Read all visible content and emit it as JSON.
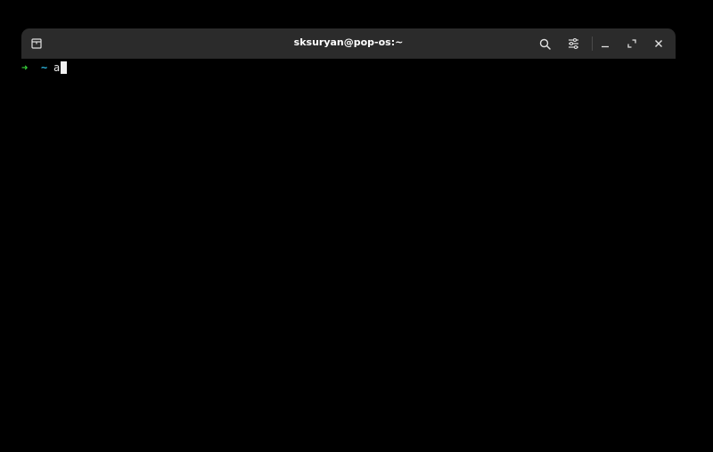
{
  "window": {
    "title": "sksuryan@pop-os:~"
  },
  "terminal": {
    "prompt_arrow": "➜",
    "prompt_dir": "~",
    "command_text": "a"
  },
  "colors": {
    "titlebar_bg": "#2b2b2b",
    "terminal_bg": "#000000",
    "prompt_arrow": "#38d23a",
    "prompt_dir": "#2ab0d8",
    "text": "#e6e6e6"
  },
  "icons": {
    "new_tab": "new-tab-icon",
    "search": "search-icon",
    "menu": "menu-icon",
    "minimize": "minimize-icon",
    "maximize": "maximize-icon",
    "close": "close-icon"
  }
}
